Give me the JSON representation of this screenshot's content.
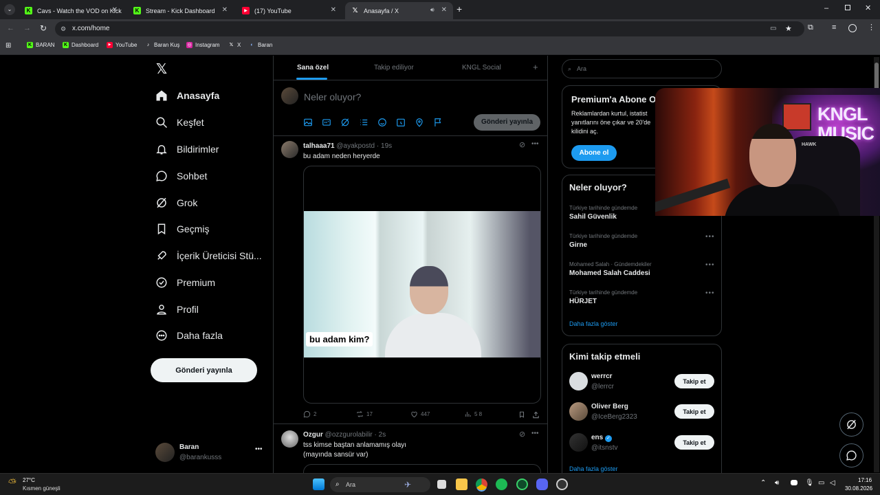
{
  "browser": {
    "tabs": [
      {
        "title": "Cavs - Watch the VOD on Kick",
        "icon": "kick-icon"
      },
      {
        "title": "Stream - Kick Dashboard",
        "icon": "kick-icon"
      },
      {
        "title": "(17) YouTube",
        "icon": "youtube-icon"
      },
      {
        "title": "Anasayfa / X",
        "icon": "x-icon"
      }
    ],
    "url": "x.com/home",
    "bookmarks": [
      "BARAN",
      "Dashboard",
      "YouTube",
      "Baran Kuş",
      "Instagram",
      "X",
      "Baran"
    ]
  },
  "sidebar": {
    "items": [
      {
        "label": "Anasayfa",
        "icon": "home-icon"
      },
      {
        "label": "Keşfet",
        "icon": "search-icon"
      },
      {
        "label": "Bildirimler",
        "icon": "bell-icon"
      },
      {
        "label": "Sohbet",
        "icon": "chat-icon"
      },
      {
        "label": "Grok",
        "icon": "grok-icon"
      },
      {
        "label": "Geçmiş",
        "icon": "bookmark-icon"
      },
      {
        "label": "İçerik Üreticisi Stü...",
        "icon": "rocket-icon"
      },
      {
        "label": "Premium",
        "icon": "verified-icon"
      },
      {
        "label": "Profil",
        "icon": "person-icon"
      },
      {
        "label": "Daha fazla",
        "icon": "more-circle-icon"
      }
    ],
    "post_button": "Gönderi yayınla",
    "account": {
      "name": "Baran",
      "handle": "@barankusss"
    }
  },
  "timeline": {
    "tabs": [
      "Sana özel",
      "Takip ediliyor",
      "KNGL Social"
    ],
    "composer_placeholder": "Neler oluyor?",
    "composer_button": "Gönderi yayınla",
    "posts": [
      {
        "name": "talhaaa71",
        "handle": "@ayakpostd",
        "time": "· 19s",
        "text": "bu adam neden heryerde",
        "media_caption": "bu adam kim?",
        "replies": "2",
        "reposts": "17",
        "likes": "447",
        "views": "5 8"
      },
      {
        "name": "Ozgur",
        "handle": "@ozzgurolabilir",
        "time": "· 2s",
        "text": "tss kimse baştan anlamamış olayı",
        "text2": "(mayında sansür var)"
      }
    ]
  },
  "right": {
    "search_placeholder": "Ara",
    "premium": {
      "title": "Premium'a Abone O",
      "line1": "Reklamlardan kurtul, istatist",
      "line2": "yanıtlarını öne çıkar ve 20'de",
      "line3": "kilidini aç.",
      "button": "Abone ol"
    },
    "trends": {
      "title": "Neler oluyor?",
      "items": [
        {
          "meta": "Türkiye tarihinde gündemde",
          "name": "Sahil Güvenlik"
        },
        {
          "meta": "Türkiye tarihinde gündemde",
          "name": "Girne"
        },
        {
          "meta": "Mohamed Salah · Gündemdekiler",
          "name": "Mohamed Salah Caddesi"
        },
        {
          "meta": "Türkiye tarihinde gündemde",
          "name": "HÜRJET"
        }
      ],
      "more": "Daha fazla göster"
    },
    "who_to_follow": {
      "title": "Kimi takip etmeli",
      "users": [
        {
          "name": "werrcr",
          "handle": "@lerrcr"
        },
        {
          "name": "Oliver Berg",
          "handle": "@IceBerg2323"
        },
        {
          "name": "ens",
          "handle": "@itsnstv"
        }
      ],
      "follow_label": "Takip et",
      "more": "Daha fazla göster"
    }
  },
  "overlay": {
    "sign_text": "KNGL MUSIC",
    "small_text": "HAWK"
  },
  "taskbar": {
    "weather_temp": "27°C",
    "weather_desc": "Kısmen güneşli",
    "search": "Ara",
    "time": "17:16",
    "date": "30.08.2026"
  }
}
